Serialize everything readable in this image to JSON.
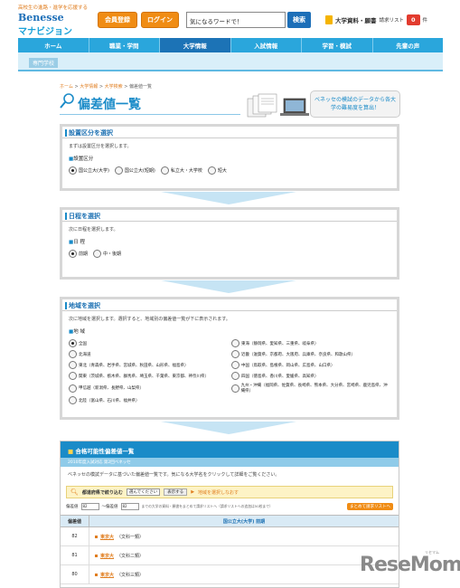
{
  "header": {
    "tagline": "高校生の進路・進学を応援する",
    "logo_brand": "Benesse",
    "logo_site": "マナビジョン",
    "register_label": "会員登録",
    "login_label": "ログイン",
    "search_value": "気になるワードで！",
    "search_button": "検索",
    "request_label": "大学資料・願書",
    "request_list_label": "請求リスト",
    "request_count": "0",
    "request_unit": "件"
  },
  "nav": {
    "items": [
      "ホーム",
      "職業・学問",
      "大学情報",
      "入試情報",
      "学習・模試",
      "先輩の声"
    ],
    "active_index": 2,
    "sub_link": "専門学校"
  },
  "breadcrumb": {
    "home": "ホーム",
    "sep": " > ",
    "level1": "大学情報",
    "level2": "大学検索",
    "current": "偏差値一覧"
  },
  "page_title": "偏差値一覧",
  "promo_text": "ベネッセの模試のデータから各大学の難易度を算出！",
  "section_type": {
    "heading": "設置区分を選択",
    "desc": "まずは設置区分を選択します。",
    "label": "設置区分",
    "options": [
      "国公立大(大学)",
      "国公立大(短期)",
      "私立大・大学校",
      "短大"
    ],
    "selected": 0
  },
  "section_schedule": {
    "heading": "日程を選択",
    "desc": "次に日程を選択します。",
    "label": "日 程",
    "options": [
      "前期",
      "中・後期"
    ],
    "selected": 0
  },
  "section_region": {
    "heading": "地域を選択",
    "desc": "次に地域を選択します。選択すると、地域別の偏差値一覧が下に表示されます。",
    "label": "地 域",
    "options_left": [
      "全国",
      "北海道",
      "東北（青森県、岩手県、宮城県、秋田県、山形県、福島県）",
      "関東（茨城県、栃木県、群馬県、埼玉県、千葉県、東京都、神奈川県）",
      "甲信越（新潟県、長野県、山梨県）",
      "北陸（富山県、石川県、福井県）"
    ],
    "options_right": [
      "東海（静岡県、愛知県、三重県、岐阜県）",
      "近畿（滋賀県、京都府、大阪府、兵庫県、奈良県、和歌山県）",
      "中国（鳥取県、島根県、岡山県、広島県、山口県）",
      "四国（徳島県、香川県、愛媛県、高知県）",
      "九州・沖縄（福岡県、佐賀県、長崎県、熊本県、大分県、宮崎県、鹿児島県、沖縄県）"
    ],
    "selected": 0
  },
  "results": {
    "heading": "合格可能性偏差値一覧",
    "sub": "2010年度入試対応 第2回ベネッセ",
    "desc": "ベネッセの模試データに基づいた偏差値一覧です。気になる大学名をクリックして詳細をご覧ください。",
    "filter_label": "都道府県で絞り込む",
    "filter_select": "選んでください",
    "filter_button": "表示する",
    "filter_link": "地域を選択しなおす",
    "dev_label_from": "偏差値",
    "dev_from": "82",
    "dev_sep": "〜偏差値",
    "dev_to": "82",
    "dev_hint": "までの大学の資料・願書をまとめて請求リストへ（請求リストへの追加は50校まで）",
    "add_button": "まとめて請求リストへ",
    "col_dev": "偏差値",
    "col_main": "国公立大(大学) 前期",
    "rows": [
      {
        "dev": "82",
        "uni": "東京大",
        "dept": "（文科一類）"
      },
      {
        "dev": "81",
        "uni": "東京大",
        "dept": "（文科二類）"
      },
      {
        "dev": "80",
        "uni": "東京大",
        "dept": "（文科三類）"
      }
    ]
  },
  "watermark": {
    "text": "ReseMom",
    "ruby": "リセマム"
  }
}
